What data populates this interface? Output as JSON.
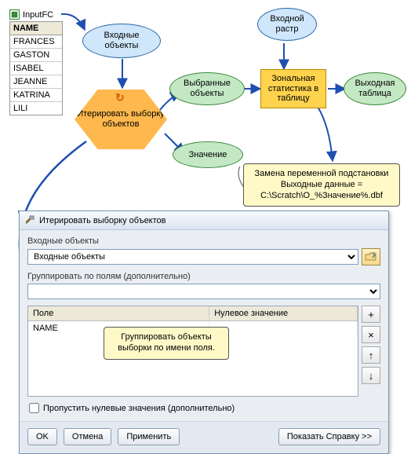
{
  "table": {
    "title": "InputFC",
    "header": "NAME",
    "rows": [
      "FRANCES",
      "GASTON",
      "ISABEL",
      "JEANNE",
      "KATRINA",
      "LILI"
    ]
  },
  "diagram": {
    "inputFeatures": "Входные объекты",
    "inputRaster": "Входной растр",
    "iterate": "Итерировать выборку объектов",
    "selected": "Выбранные объекты",
    "value": "Значение",
    "zonal": "Зональная статистика в таблицу",
    "output": "Выходная таблица"
  },
  "callouts": {
    "sub": [
      "Замена переменной подстановки",
      "Выходные данные =",
      "C:\\Scratch\\O_%Значение%.dbf"
    ],
    "group": [
      "Группировать объекты",
      "выборки по имени поля."
    ]
  },
  "dialog": {
    "title": "Итерировать выборку объектов",
    "inputLabel": "Входные объекты",
    "inputValue": "Входные объекты",
    "groupLabel": "Группировать по полям (дополнительно)",
    "cols": [
      "Поле",
      "Нулевое значение"
    ],
    "fieldRows": [
      "NAME"
    ],
    "sideBtns": [
      "+",
      "×",
      "↑",
      "↓"
    ],
    "skipLabel": "Пропустить нулевые значения (дополнительно)",
    "buttons": {
      "ok": "OK",
      "cancel": "Отмена",
      "apply": "Применить",
      "help": "Показать Справку >>"
    }
  }
}
